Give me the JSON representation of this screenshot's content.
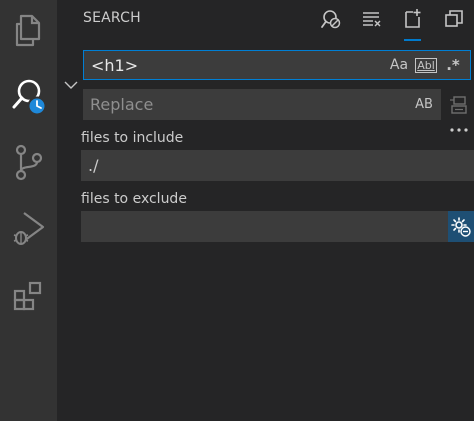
{
  "activity_bar": {
    "items": [
      {
        "name": "explorer",
        "icon": "files-icon"
      },
      {
        "name": "search",
        "icon": "search-icon",
        "active": true
      },
      {
        "name": "source-control",
        "icon": "source-control-icon"
      },
      {
        "name": "run-debug",
        "icon": "run-debug-icon"
      },
      {
        "name": "extensions",
        "icon": "extensions-icon"
      }
    ]
  },
  "sidebar": {
    "title": "SEARCH",
    "actions": [
      {
        "name": "clear-results",
        "icon": "clear-results-icon"
      },
      {
        "name": "collapse-all",
        "icon": "collapse-all-icon"
      },
      {
        "name": "new-search-editor",
        "icon": "new-file-icon"
      },
      {
        "name": "view-as-tree",
        "icon": "window-icon"
      }
    ]
  },
  "search": {
    "value": "<h1>",
    "options": {
      "match_case": "Aa",
      "whole_word": "Abl",
      "regex": ".*"
    }
  },
  "replace": {
    "placeholder": "Replace",
    "preserve_case": "AB"
  },
  "include": {
    "label": "files to include",
    "value": "./"
  },
  "exclude": {
    "label": "files to exclude",
    "value": ""
  },
  "colors": {
    "accent": "#007acc",
    "input_bg": "#3c3c3c",
    "activity_bar_bg": "#333333",
    "sidebar_bg": "#252526"
  }
}
